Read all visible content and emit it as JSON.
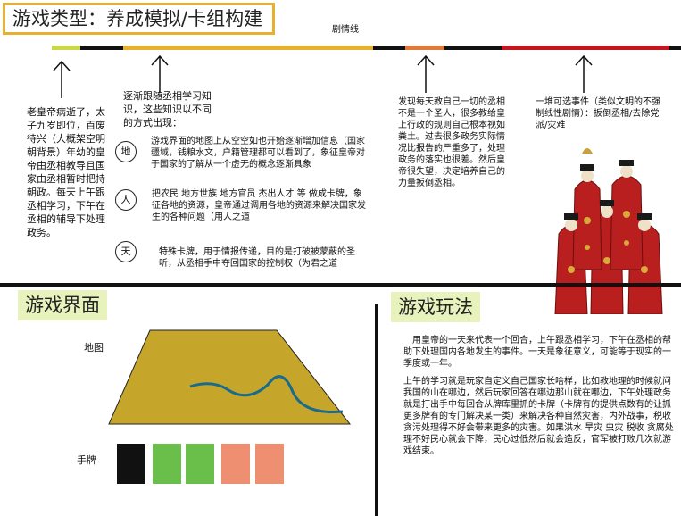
{
  "title": "游戏类型：养成模拟/卡组构建",
  "timeline": {
    "label": "剧情线",
    "colors": {
      "yellow": "#e8b030",
      "lime": "#c8d84a",
      "black": "#111111",
      "orange": "#e07a3a",
      "red": "#c0181e"
    }
  },
  "notes": {
    "story1": "老皇帝病逝了，太子九岁即位，百废待兴（大概架空明朝背景）年幼的皇帝由丞相教导且国家由丞相暂时把持朝政。每天上午跟丞相学习，下午在丞相的辅导下处理政务。",
    "story2": "逐渐跟随丞相学习知识，这些知识以不同的方式出现：",
    "story3": "发现每天教自己一切的丞相不是一个圣人，很多教给皇上行政的规则自己根本视如粪土。过去很多政务实际情况比报告的严重多了，处理政务的落实也很差。然后皇帝很失望，决定培养自己的力量扳倒丞相。",
    "story4": "一堆可选事件（类似文明的不强制线性剧情）：扳倒丞相/去除党派/灾难"
  },
  "knowledge": [
    {
      "symbol": "地",
      "text": "游戏界面的地图上从空空如也开始逐渐增加信息（国家疆域，钱粮水文，户籍管理都可以看到了，象征皇帝对于国家的了解从一个虚无的概念逐渐具象"
    },
    {
      "symbol": "人",
      "text": "把农民 地方世族 地方官员 杰出人才 等 做成卡牌，象征各地的资源，皇帝通过调用各地的资源来解决国家发生的各种问题（用人之道"
    },
    {
      "symbol": "天",
      "text": "特殊卡牌，用于情报传递，目的是打破被蒙蔽的圣听，从丞相手中夺回国家的控制权（为君之道"
    }
  ],
  "interface_section": {
    "heading": "游戏界面",
    "map_label": "地图",
    "hand_label": "手牌",
    "map_fill": "#c6a62a",
    "river_color": "#1a6a8c",
    "card_colors": [
      "#111111",
      "#6abf4b",
      "#6abf4b",
      "#ee8f72",
      "#ee8f72"
    ]
  },
  "gameplay_section": {
    "heading": "游戏玩法",
    "para1": "用皇帝的一天来代表一个回合，上午跟丞相学习，下午在丞相的帮助下处理国内各地发生的事件。一天是象征意义，可能等于现实的一季度或一年。",
    "para2": "上午的学习就是玩家自定义自己国家长啥样，比如教地理的时候就问我国的山在哪边，然后玩家回答在哪边那山就在哪边，下午处理政务就是打出手中每回合从牌库里抓的卡牌（卡牌有的提供点数有的让抓更多牌有的专门解决某一类）来解决各种自然灾害，内外战事，税收贪污处理得不好会带来更多的灾害。如果洪水 旱灾 虫灾 税收 贪腐处理不好民心就会下降，民心过低然后就会造反，官军被打败几次就游戏结束。"
  }
}
